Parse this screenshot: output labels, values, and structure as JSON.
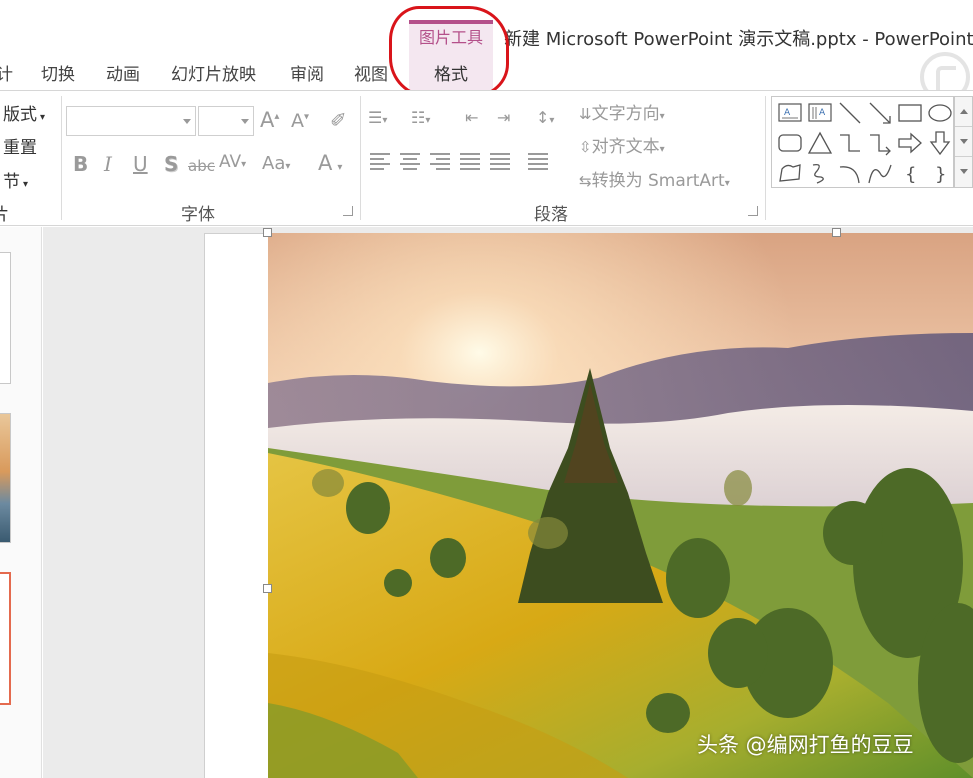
{
  "window": {
    "document_title": "新建 Microsoft PowerPoint 演示文稿.pptx - PowerPoint",
    "context_tab_group": "图片工具"
  },
  "tabs": {
    "partial_left": "计",
    "transitions": "切换",
    "animations": "动画",
    "slideshow": "幻灯片放映",
    "review": "审阅",
    "view": "视图",
    "format": "格式"
  },
  "ribbon": {
    "slides_group": {
      "layout": "版式",
      "reset": "重置",
      "section": "节",
      "label_partial": "片"
    },
    "font_group": {
      "label": "字体",
      "grow_font": "A",
      "shrink_font": "A",
      "bold": "B",
      "italic": "I",
      "underline": "U",
      "shadow": "S",
      "strikethrough": "abc",
      "char_spacing": "AV",
      "change_case": "Aa",
      "font_color": "A"
    },
    "paragraph_group": {
      "label": "段落",
      "text_direction": "文字方向",
      "align_text": "对齐文本",
      "convert_smartart": "转换为 SmartArt"
    },
    "drawing_group": {
      "shapes": [
        "text-box",
        "vertical-text-box",
        "line",
        "arrow-line",
        "rectangle",
        "oval",
        "rounded-rectangle",
        "triangle",
        "elbow-connector",
        "elbow-arrow-connector",
        "right-arrow",
        "down-arrow",
        "freeform",
        "scribble",
        "arc",
        "curve",
        "left-brace",
        "right-brace"
      ]
    }
  },
  "watermark": "头条 @编网打鱼的豆豆",
  "colors": {
    "context_accent": "#b4508a",
    "context_band": "#f4e7f0",
    "annotation_red": "#d9141a",
    "selected_thumb_border": "#e46a4e"
  }
}
